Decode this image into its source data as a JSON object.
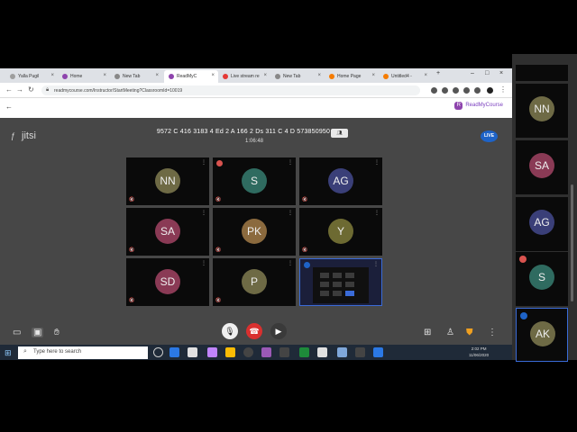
{
  "browser": {
    "tabs": [
      {
        "label": "Yalla Pugil",
        "color": "#9e9e9e",
        "active": false
      },
      {
        "label": "Home",
        "color": "#8e44ad",
        "active": false
      },
      {
        "label": "New Tab",
        "color": "#888888",
        "active": false
      },
      {
        "label": "ReadMyC",
        "color": "#8e44ad",
        "active": true
      },
      {
        "label": "Live stream re",
        "color": "#e53935",
        "active": false
      },
      {
        "label": "New Tab",
        "color": "#888888",
        "active": false
      },
      {
        "label": "Home Page",
        "color": "#f57c00",
        "active": false
      },
      {
        "label": "Untitled4 -",
        "color": "#f57c00",
        "active": false
      }
    ],
    "url": "readmycourse.com/Instructor/StartMeeting?ClassroomId=10019",
    "brand": "ReadMyCourse",
    "brand_color": "#7b3fbf"
  },
  "meeting": {
    "logo_text": "jitsi",
    "title": "9572 C 416 3183 4 Ed 2 A 166 2 Ds 311 C 4 D 573850950",
    "title_badge": "",
    "timer": "1:06:48",
    "live_badge": "LIVE",
    "participants": [
      {
        "initials": "NN",
        "color": "#6e6a45",
        "marker": "none"
      },
      {
        "initials": "S",
        "color": "#2f6b60",
        "marker": "hand"
      },
      {
        "initials": "AG",
        "color": "#3a3f78",
        "marker": "none"
      },
      {
        "initials": "SA",
        "color": "#8a3a55",
        "marker": "none"
      },
      {
        "initials": "PK",
        "color": "#8b6a3e",
        "marker": "none"
      },
      {
        "initials": "Y",
        "color": "#6d6a32",
        "marker": "none"
      },
      {
        "initials": "SD",
        "color": "#8a3a55",
        "marker": "none"
      },
      {
        "initials": "P",
        "color": "#6e6a45",
        "marker": "none"
      }
    ],
    "tile_mic_label": "🔇"
  },
  "filmstrip": [
    {
      "initials": "NN",
      "color": "#6e6a45",
      "marker": "none"
    },
    {
      "initials": "SA",
      "color": "#8a3a55",
      "marker": "none"
    },
    {
      "initials": "AG",
      "color": "#3a3f78",
      "marker": "none"
    },
    {
      "initials": "S",
      "color": "#2f6b60",
      "marker": "hand"
    },
    {
      "initials": "AK",
      "color": "#6e6a45",
      "marker": "pin"
    }
  ],
  "taskbar": {
    "search_placeholder": "Type here to search",
    "time": "2:02 PM",
    "date": "11/06/2020",
    "apps": [
      "#f0c040",
      "#2b78e4",
      "#e0e0e0",
      "#c084fc",
      "#fbbc05",
      "#444444",
      "#9b59b6",
      "#444444",
      "#1e8a3a",
      "#e0e0e0",
      "#7fa7d9",
      "#444444",
      "#2b78e4"
    ]
  }
}
